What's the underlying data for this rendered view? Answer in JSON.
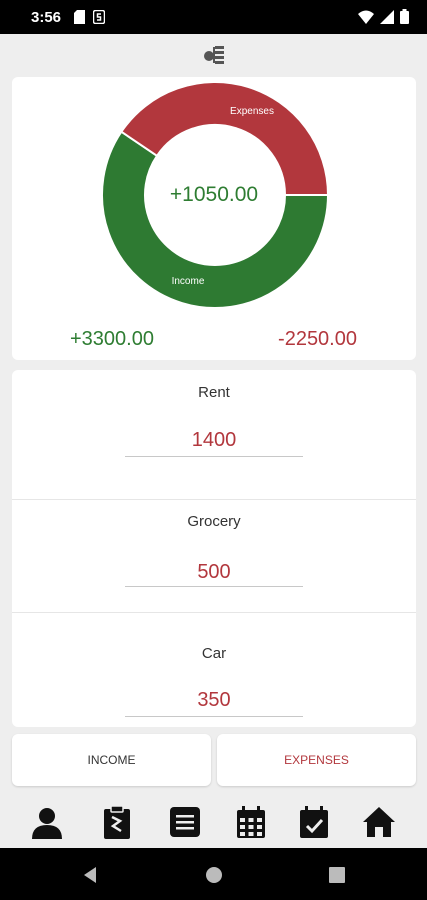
{
  "status_bar": {
    "time": "3:56"
  },
  "summary": {
    "balance": "+1050.00",
    "income_total": "+3300.00",
    "expenses_total": "-2250.00",
    "income_label": "Income",
    "expenses_label": "Expenses"
  },
  "chart_data": {
    "type": "pie",
    "labels": [
      "Income",
      "Expenses"
    ],
    "values": [
      3300,
      2250
    ],
    "colors": [
      "#2e7a32",
      "#b2373d"
    ]
  },
  "expenses": [
    {
      "name": "Rent",
      "value": "1400"
    },
    {
      "name": "Grocery",
      "value": "500"
    },
    {
      "name": "Car",
      "value": "350"
    }
  ],
  "tabs": {
    "income": "INCOME",
    "expenses": "EXPENSES"
  },
  "nav_items": [
    "profile-icon",
    "clipboard-icon",
    "list-icon",
    "calendar-icon",
    "calendar-check-icon",
    "home-icon"
  ],
  "colors": {
    "income": "#2e7d32",
    "expense": "#b2373d"
  }
}
